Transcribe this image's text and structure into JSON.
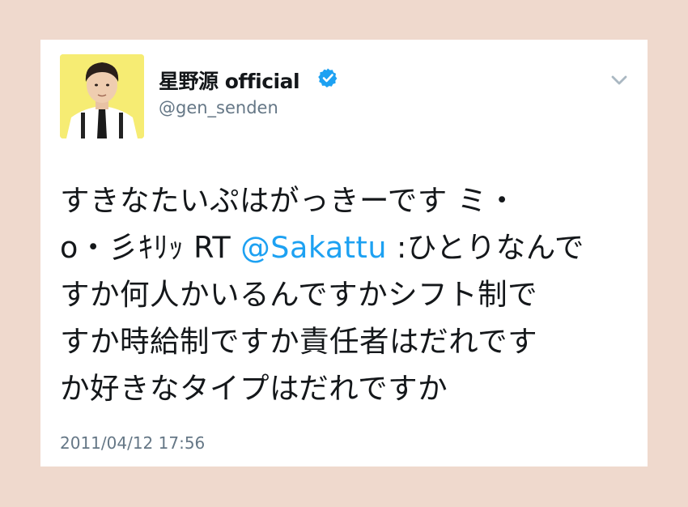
{
  "tweet": {
    "display_name": "星野源 official",
    "handle": "@gen_senden",
    "verified": true,
    "text_lines": {
      "l1": "すきなたいぷはがっきーです ミ・",
      "l2_pre": "o・彡ｷﾘｯ RT ",
      "l2_mention": "@Sakattu",
      "l2_post": " :ひとりなんで",
      "l3": "すか何人かいるんですかシフト制で",
      "l4": "すか時給制ですか責任者はだれです",
      "l5": "か好きなタイプはだれですか"
    },
    "timestamp": "2011/04/12 17:56"
  },
  "icons": {
    "verified": "verified-badge-icon",
    "menu": "chevron-down-icon"
  },
  "colors": {
    "background": "#efd9cd",
    "card": "#ffffff",
    "text": "#14171a",
    "secondary": "#657786",
    "link": "#1da1f2",
    "verified": "#1da1f2"
  }
}
